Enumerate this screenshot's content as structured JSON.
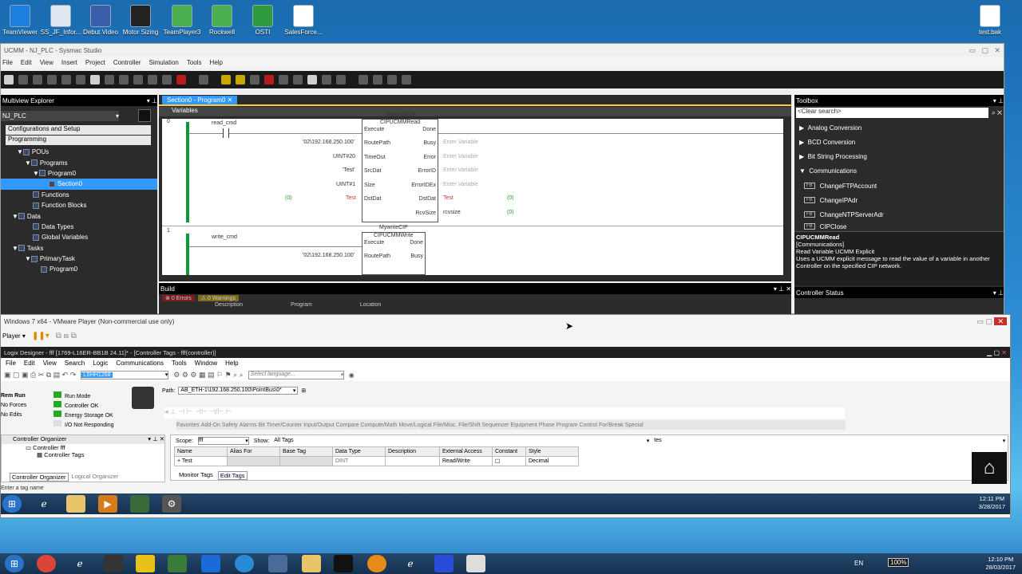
{
  "desktop": {
    "icons": [
      "TeamViewer",
      "SS_JF_Infor...",
      "Debut Video",
      "Motor Sizing",
      "TeamPlayer3",
      "Rockwell",
      "OSTI",
      "SalesForce..."
    ],
    "right_icon": "test.bak"
  },
  "sysmac": {
    "title": "UCMM - NJ_PLC - Sysmac Studio",
    "menu": [
      "File",
      "Edit",
      "View",
      "Insert",
      "Project",
      "Controller",
      "Simulation",
      "Tools",
      "Help"
    ],
    "explorer": {
      "title": "Multiview Explorer",
      "device": "NJ_PLC",
      "section1": "Configurations and Setup",
      "section2": "Programming",
      "tree": [
        "POUs",
        "Programs",
        "Program0",
        "Section0",
        "Functions",
        "Function Blocks",
        "Data",
        "Data Types",
        "Global Variables",
        "Tasks",
        "PrimaryTask",
        "Program0"
      ]
    },
    "editor": {
      "tab": "Section0 - Program0",
      "variables": "Variables",
      "rung0": {
        "num": "0",
        "contact": "read_cmd",
        "instance": "MyReadCIP",
        "fb": "CIPUCMMRead",
        "inputs": [
          "Execute",
          "RoutePath",
          "TimeOut",
          "SrcDat",
          "Size",
          "DstDat"
        ],
        "outputs": [
          "Done",
          "Busy",
          "Error",
          "ErrorID",
          "ErrorIDEx",
          "DstDat",
          "RcvSize"
        ],
        "in_vals": [
          "'02\\192.168.250.100'",
          "UINT#20",
          "'Test'",
          "UINT#1",
          "Test"
        ],
        "out_vals": [
          "Enter Variable",
          "Enter Variable",
          "Enter Variable",
          "Enter Variable",
          "Test",
          "rcvsize"
        ],
        "zero": "(0)"
      },
      "rung1": {
        "num": "1",
        "contact": "write_cmd",
        "instance": "MywriteCIP",
        "fb": "CIPUCMMWrite",
        "in1": "Execute",
        "in2": "RoutePath",
        "out1": "Done",
        "out2": "Busy",
        "val": "'02\\192.168.250.100'"
      }
    },
    "build": {
      "title": "Build",
      "errors": "0 Errors",
      "warnings": "0 Warnings",
      "cols": [
        "Description",
        "Program",
        "Location"
      ]
    },
    "toolbox": {
      "title": "Toolbox",
      "search": "<Clear search>",
      "cats": [
        "Analog Conversion",
        "BCD Conversion",
        "Bit String Processing",
        "Communications"
      ],
      "items": [
        "ChangeFTPAccount",
        "ChangeIPAdr",
        "ChangeNTPServerAdr",
        "CIPClose"
      ],
      "fbtag": "FB",
      "help_title": "CIPUCMMRead",
      "help_cat": "[Communications]",
      "help_sub": "Read Variable UCMM Explicit",
      "help_text": "Uses a UCMM explicit message to read the value of a variable in another Controller on the specified CIP network.",
      "status": "Controller Status"
    }
  },
  "vmware": {
    "title": "Windows 7 x64 - VMware Player (Non-commercial use only)",
    "player": "Player",
    "ld": {
      "title": "Logix Designer - fff [1769-L16ER-BB1B 24.11]* - [Controller Tags - fff(controller)]",
      "menu": [
        "File",
        "Edit",
        "View",
        "Search",
        "Logic",
        "Communications",
        "Tools",
        "Window",
        "Help"
      ],
      "combo": "LSHH1268",
      "lang": "Select language...",
      "path_label": "Path:",
      "path": "AB_ETH-1\\192.168.250.100\\PointBus\\0*",
      "status": [
        "Rem Run",
        "No Forces",
        "No Edits"
      ],
      "modes": [
        "Run Mode",
        "Controller OK",
        "Energy Storage OK",
        "I/O Not Responding"
      ],
      "tabs": [
        "Favorites",
        "Add-On",
        "Safety",
        "Alarms",
        "Bit",
        "Timer/Counter",
        "Input/Output",
        "Compare",
        "Compute/Math",
        "Move/Logical",
        "File/Misc.",
        "File/Shift",
        "Sequencer",
        "Equipment Phase",
        "Program Control",
        "For/Break",
        "Special"
      ],
      "organizer": "Controller Organizer",
      "org_items": [
        "Controller fff",
        "Controller Tags"
      ],
      "org_tabs": [
        "Controller Organizer",
        "Logical Organizer"
      ],
      "scope_label": "Scope:",
      "scope": "fff",
      "show_label": "Show:",
      "show": "All Tags",
      "filter": "tes",
      "cols": [
        "Name",
        "Alias For",
        "Base Tag",
        "Data Type",
        "Description",
        "External Access",
        "Constant",
        "Style"
      ],
      "row": {
        "name": "Test",
        "type": "DINT",
        "access": "Read/Write",
        "style": "Decimal"
      },
      "sheet_tabs": [
        "Monitor Tags",
        "Edit Tags"
      ],
      "statusbar": "Enter a tag name"
    },
    "clock": {
      "time": "12:11 PM",
      "date": "3/28/2017"
    }
  },
  "host_clock": {
    "time": "12:10 PM",
    "date": "28/03/2017",
    "lang": "EN",
    "battery": "100%"
  }
}
